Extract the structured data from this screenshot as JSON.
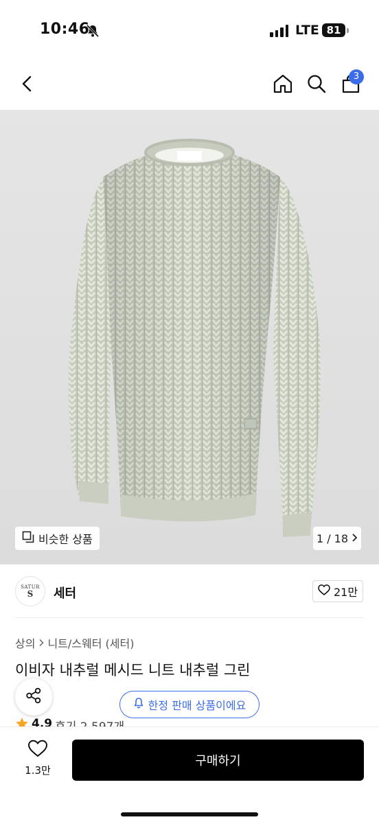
{
  "status_bar": {
    "time": "10:46",
    "network": "LTE",
    "battery": "81",
    "icons": [
      "bell-slash-icon",
      "signal-icon",
      "battery-icon"
    ]
  },
  "header": {
    "icons": [
      "back-icon",
      "home-icon",
      "search-icon",
      "cart-icon"
    ],
    "cart_count": "3",
    "accent_color": "#3d6de6"
  },
  "product_image": {
    "similar_label": "비슷한 상품",
    "page_counter": "1 / 18",
    "icons": [
      "similar-icon",
      "chevron-right-icon"
    ]
  },
  "brand": {
    "name": "세터",
    "logo_text": "SATUR",
    "logo_mark": "S",
    "like_count": "21만"
  },
  "product": {
    "breadcrumb": [
      "상의",
      "니트/스웨터 (세터)"
    ],
    "title": "이비자 내추럴 메시드 니트 내추럴 그린",
    "limited_notice": "한정 판매 상품이에요",
    "rating": "4.9",
    "review_count": "후기 2,597개"
  },
  "bottom_bar": {
    "wish_count": "1.3만",
    "buy_label": "구매하기"
  }
}
